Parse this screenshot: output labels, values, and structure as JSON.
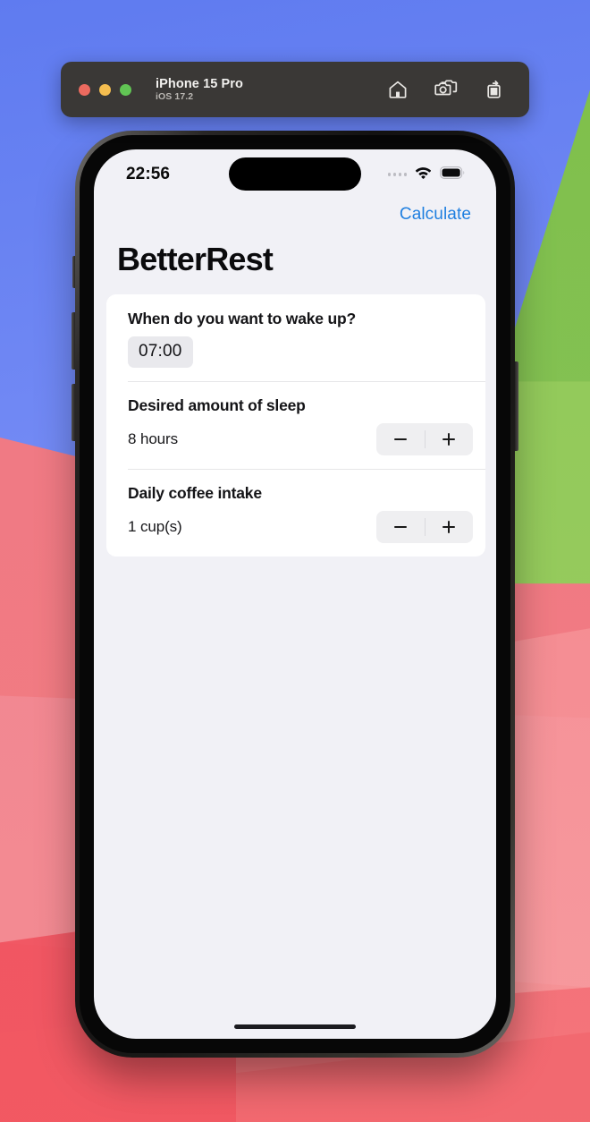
{
  "simulator": {
    "device_name": "iPhone 15 Pro",
    "os_version": "iOS 17.2",
    "window_controls": [
      {
        "name": "close",
        "color": "#ec6a5f"
      },
      {
        "name": "minimize",
        "color": "#f4bd4f"
      },
      {
        "name": "zoom",
        "color": "#61c554"
      }
    ],
    "actions": [
      {
        "icon": "home-icon",
        "label": "Home"
      },
      {
        "icon": "screenshot-icon",
        "label": "Screenshot"
      },
      {
        "icon": "rotate-icon",
        "label": "Rotate"
      }
    ]
  },
  "status_bar": {
    "time": "22:56",
    "cellular_icon": "signal-dots-icon",
    "wifi_icon": "wifi-icon",
    "battery_icon": "battery-full-icon"
  },
  "nav": {
    "calculate_label": "Calculate",
    "accent_color": "#1f7fe0"
  },
  "app": {
    "title": "BetterRest"
  },
  "form": {
    "sections": [
      {
        "label": "When do you want to wake up?",
        "control": "time-picker",
        "value": "07:00"
      },
      {
        "label": "Desired amount of sleep",
        "control": "stepper",
        "value": "8 hours",
        "decrement_label": "−",
        "increment_label": "+"
      },
      {
        "label": "Daily coffee intake",
        "control": "stepper",
        "value": "1 cup(s)",
        "decrement_label": "−",
        "increment_label": "+"
      }
    ]
  },
  "colors": {
    "screen_background": "#f1f1f6",
    "card_background": "#ffffff",
    "chip_background": "#e9e9ed",
    "stepper_background": "#efeff1",
    "toolbar_background": "#3a3836"
  }
}
